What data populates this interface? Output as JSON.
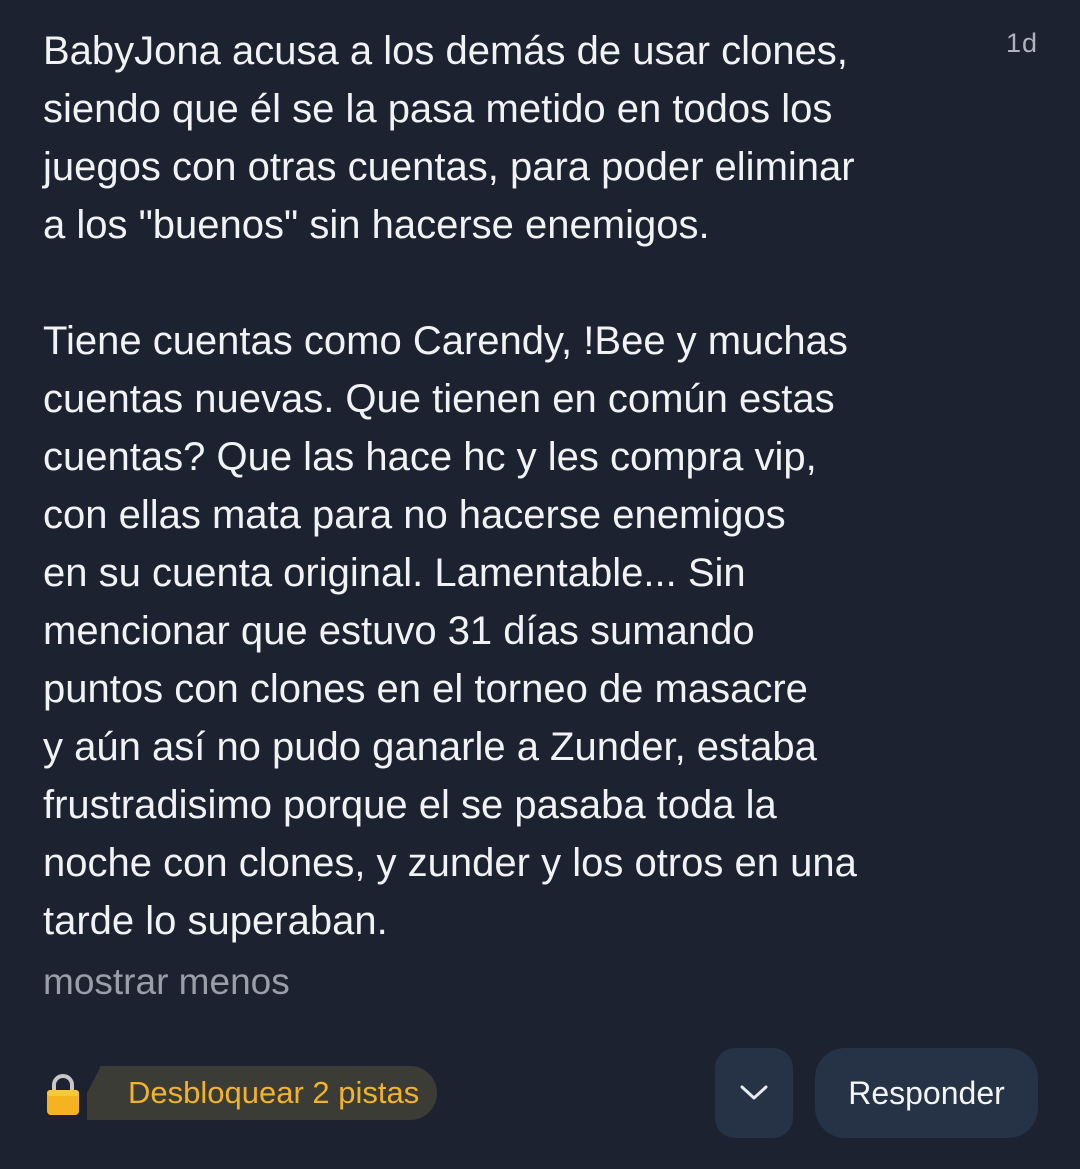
{
  "comment": {
    "timestamp": "1d",
    "paragraph1": "BabyJona acusa a los demás de usar clones,\nsiendo que él se la pasa metido en todos los\njuegos con otras cuentas, para poder eliminar\na los \"buenos\" sin hacerse enemigos.",
    "paragraph2": "Tiene cuentas como Carendy, !Bee y muchas\ncuentas nuevas. Que tienen en común estas\ncuentas? Que las hace hc y les compra vip,\ncon ellas mata para no hacerse enemigos\nen su cuenta original. Lamentable... Sin\nmencionar que estuvo 31 días sumando\npuntos con clones en el torneo de masacre\ny aún así no pudo ganarle a Zunder, estaba\nfrustradisimo porque el se pasaba toda la\nnoche con clones, y zunder y los otros en una\ntarde lo superaban.",
    "show_less_label": "mostrar menos"
  },
  "footer": {
    "unlock_hints_label": "Desbloquear 2 pistas",
    "reply_label": "Responder",
    "lock_icon": "lock-icon",
    "expand_icon": "chevron-down-icon"
  },
  "colors": {
    "background": "#1d2230",
    "text": "#f1f2f4",
    "muted_text": "#9a9ea8",
    "hint_text": "#f2b22a",
    "button_bg": "#263246",
    "pill_bg": "#3b3c36"
  }
}
